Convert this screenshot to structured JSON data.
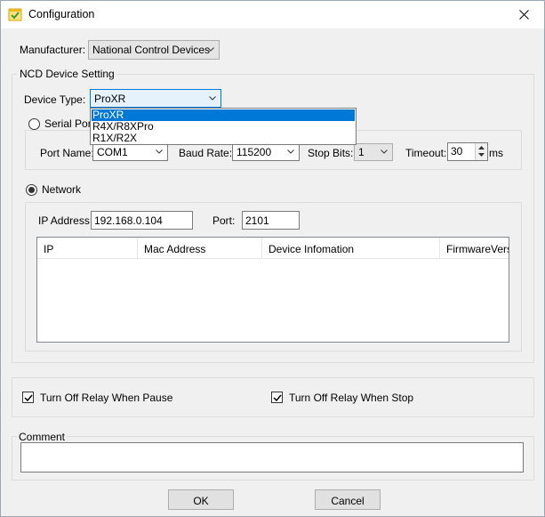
{
  "window": {
    "title": "Configuration"
  },
  "manufacturer": {
    "label": "Manufacturer:",
    "value": "National Control Devices"
  },
  "ncd_group": {
    "title": "NCD Device Setting"
  },
  "device_type": {
    "label": "Device Type:",
    "value": "ProXR",
    "options": [
      "ProXR",
      "R4X/R8XPro",
      "R1X/R2X"
    ]
  },
  "serial": {
    "label": "Serial Port",
    "port_name_label": "Port Name:",
    "port_name": "COM1",
    "baud_rate_label": "Baud Rate:",
    "baud_rate": "115200",
    "stop_bits_label": "Stop Bits:",
    "stop_bits": "1",
    "timeout_label": "Timeout:",
    "timeout": "30",
    "timeout_unit": "ms"
  },
  "network": {
    "label": "Network",
    "ip_label": "IP Address:",
    "ip": "192.168.0.104",
    "port_label": "Port:",
    "port": "2101",
    "columns": [
      "IP",
      "Mac Address",
      "Device Infomation",
      "FirmwareVersio"
    ]
  },
  "options": {
    "relay_pause": "Turn Off Relay When Pause",
    "relay_stop": "Turn Off Relay When Stop"
  },
  "comment": {
    "title": "Comment",
    "value": ""
  },
  "buttons": {
    "ok": "OK",
    "cancel": "Cancel"
  }
}
